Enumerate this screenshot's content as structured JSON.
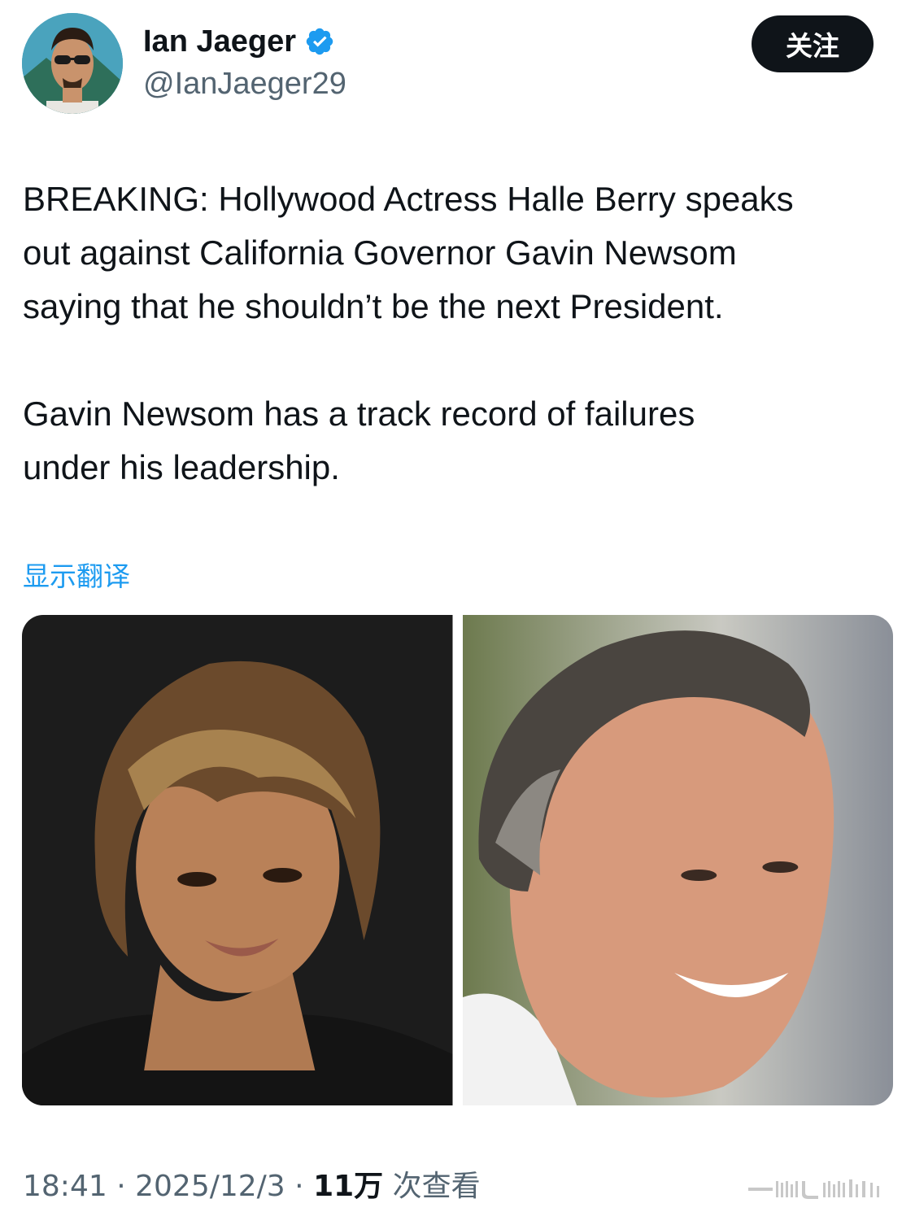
{
  "author": {
    "display_name": "Ian Jaeger",
    "handle": "@IanJaeger29",
    "verified": true,
    "verified_color": "#1d9bf0"
  },
  "follow_button": {
    "label": "关注"
  },
  "tweet": {
    "paragraph1": [
      "BREAKING: Hollywood Actress Halle Berry speaks",
      "out against California Governor Gavin Newsom",
      "saying that he shouldn’t be the next President."
    ],
    "paragraph2": [
      "Gavin Newsom has a track record of failures",
      "under his leadership."
    ]
  },
  "translate_link": "显示翻译",
  "media": {
    "count": 2,
    "items": [
      {
        "icon": "photo-woman-portrait"
      },
      {
        "icon": "photo-man-portrait"
      }
    ]
  },
  "meta": {
    "time": "18:41",
    "separator": "·",
    "date": "2025/12/3",
    "views_count": "11万",
    "views_label": "次查看"
  },
  "colors": {
    "text": "#0f1419",
    "secondary": "#536471",
    "link": "#1d9bf0",
    "button_bg": "#0f1419"
  }
}
